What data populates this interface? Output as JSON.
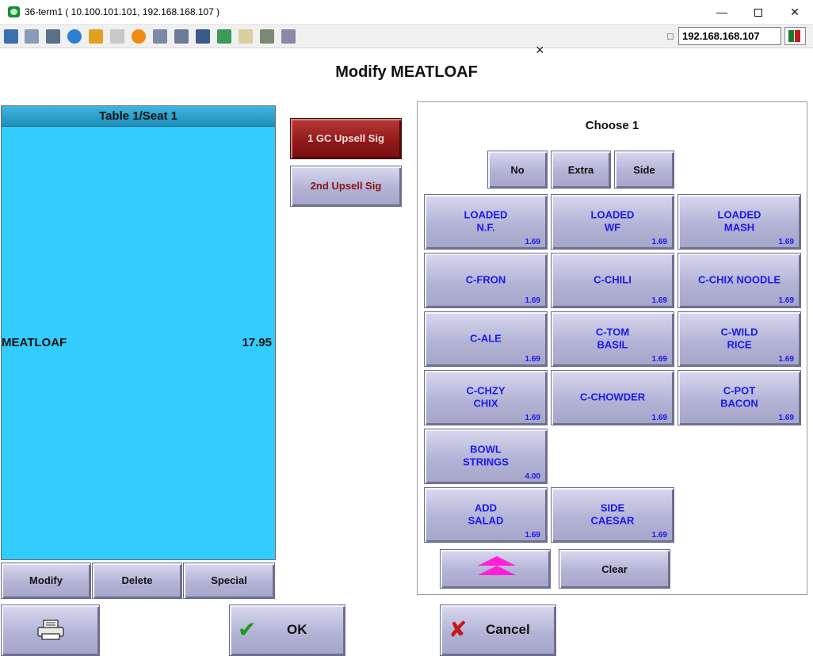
{
  "window": {
    "title": "36-term1 ( 10.100.101.101, 192.168.168.107 )",
    "ip_address": "192.168.168.107"
  },
  "dialog": {
    "title": "Modify MEATLOAF",
    "close_glyph": "×"
  },
  "check": {
    "header": "Table 1/Seat 1",
    "items": [
      {
        "name": "MEATLOAF",
        "price": "17.95"
      }
    ],
    "actions": {
      "modify": "Modify",
      "delete": "Delete",
      "special": "Special"
    }
  },
  "upsell": {
    "first": "1 GC Upsell Sig",
    "second": "2nd Upsell Sig"
  },
  "modifiers": {
    "prompt": "Choose 1",
    "qualifiers": [
      "No",
      "Extra",
      "Side"
    ],
    "items": [
      {
        "label": "LOADED\nN.F.",
        "price": "1.69"
      },
      {
        "label": "LOADED\nWF",
        "price": "1.69"
      },
      {
        "label": "LOADED\nMASH",
        "price": "1.69"
      },
      {
        "label": "C-FRON",
        "price": "1.69"
      },
      {
        "label": "C-CHILI",
        "price": "1.69"
      },
      {
        "label": "C-CHIX NOODLE",
        "price": "1.69"
      },
      {
        "label": "C-ALE",
        "price": "1.69"
      },
      {
        "label": "C-TOM\nBASIL",
        "price": "1.69"
      },
      {
        "label": "C-WILD\nRICE",
        "price": "1.69"
      },
      {
        "label": "C-CHZY\nCHIX",
        "price": "1.69"
      },
      {
        "label": "C-CHOWDER",
        "price": "1.69"
      },
      {
        "label": "C-POT\nBACON",
        "price": "1.69"
      },
      {
        "label": "BOWL\nSTRINGS",
        "price": "4.00"
      },
      {
        "label": "ADD\nSALAD",
        "price": "1.69"
      },
      {
        "label": "SIDE\nCAESAR",
        "price": "1.69"
      }
    ],
    "clear": "Clear"
  },
  "footer": {
    "ok": "OK",
    "cancel": "Cancel"
  },
  "icons": {
    "print": "printer-icon",
    "ok": "checkmark-icon",
    "cancel": "x-icon",
    "scroll": "scroll-up-icon"
  },
  "colors": {
    "check_bg": "#33ccff",
    "modifier_text": "#1a1aee",
    "upsell_red": "#8e1717",
    "scroll_arrow": "#ff1fd6"
  }
}
